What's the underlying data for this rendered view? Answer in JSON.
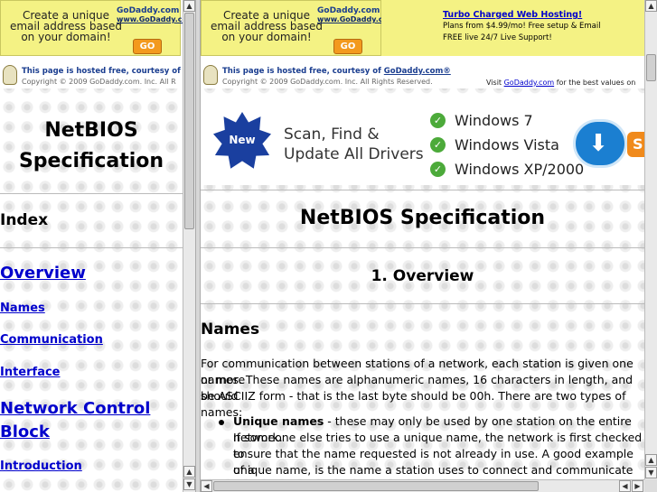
{
  "ad_banner": {
    "line1": "Create a unique",
    "line2": "email address based",
    "line3": "on your domain!",
    "logo_text": "GoDaddy.com",
    "logo_url": "www.GoDaddy.com",
    "go": "GO"
  },
  "host_notice": {
    "hosted_prefix": "This page is hosted free, courtesy of",
    "hosted_link_left": "Go",
    "hosted_link_right": "GoDaddy.com®",
    "copyright_left": "Copyright © 2009 GoDaddy.com. Inc. All R",
    "copyright_right": "Copyright © 2009 GoDaddy.com. Inc. All Rights Reserved.",
    "visit_prefix": "Visit",
    "visit_link": "GoDaddy.com",
    "visit_suffix": "for the best values on"
  },
  "turbo_ad": {
    "heading": "Turbo Charged Web Hosting!",
    "line1": "Plans from $4.99/mo! Free setup & Email",
    "line2": "FREE live 24/7 Live Support!"
  },
  "left_frame": {
    "title_line1": "NetBIOS",
    "title_line2": "Specification",
    "index_label": "Index",
    "links": [
      {
        "label": "Overview"
      },
      {
        "label": "Names"
      },
      {
        "label": "Communication"
      },
      {
        "label": "Interface"
      },
      {
        "label": "Network Control"
      },
      {
        "label": "Block"
      },
      {
        "label": "Introduction"
      }
    ]
  },
  "driver_ad": {
    "badge": "New",
    "scan_line1": "Scan, Find &",
    "scan_line2": "Update All Drivers",
    "os_items": [
      "Windows 7",
      "Windows Vista",
      "Windows XP/2000"
    ],
    "button_partial": "S"
  },
  "main": {
    "title": "NetBIOS Specification",
    "section": "1. Overview",
    "subheading": "Names",
    "paragraph_lines": [
      "For communication between stations of a network, each station is given one or more",
      "names. These names are alphanumeric names, 16 characters in length, and should",
      "be ASCIIZ form - that is the last byte should be 00h. There are two types of names:"
    ],
    "bullet_title": "Unique names",
    "bullet_lines": [
      " - these may only be used by one station on the entire network.",
      "If someone else tries to use a unique name, the network is first checked to",
      "ensure that the name requested is not already in use. A good example of a",
      "unique name, is the name a station uses to connect and communicate with the"
    ]
  },
  "colors": {
    "ad_yellow": "#f4f284",
    "link_blue": "#0000cc",
    "go_orange": "#f39a1e",
    "check_green": "#4caa3a"
  }
}
